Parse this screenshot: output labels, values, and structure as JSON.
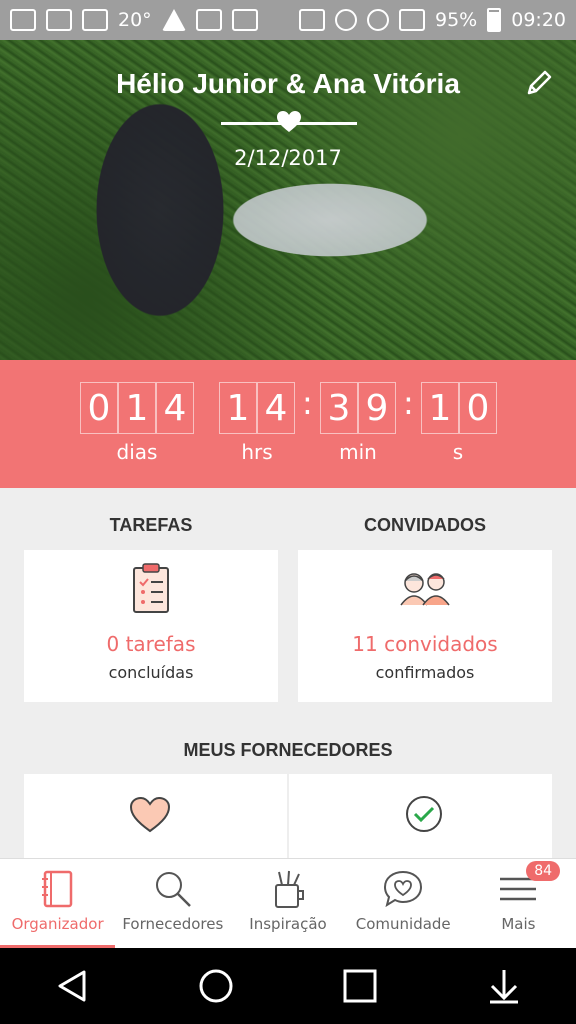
{
  "status_bar": {
    "temperature": "20°",
    "battery": "95%",
    "time": "09:20"
  },
  "hero": {
    "names": "Hélio Junior & Ana Vitória",
    "date": "2/12/2017"
  },
  "countdown": {
    "days": [
      "0",
      "1",
      "4"
    ],
    "hours": [
      "1",
      "4"
    ],
    "minutes": [
      "3",
      "9"
    ],
    "seconds": [
      "1",
      "0"
    ],
    "labels": {
      "days": "dias",
      "hours": "hrs",
      "minutes": "min",
      "seconds": "s"
    }
  },
  "tasks": {
    "title": "TAREFAS",
    "count": "0 tarefas",
    "sub": "concluídas"
  },
  "guests": {
    "title": "CONVIDADOS",
    "count": "11 convidados",
    "sub": "confirmados"
  },
  "vendors": {
    "title": "MEUS FORNECEDORES"
  },
  "nav": {
    "items": [
      {
        "label": "Organizador",
        "icon": "notebook-icon"
      },
      {
        "label": "Fornecedores",
        "icon": "search-icon"
      },
      {
        "label": "Inspiração",
        "icon": "tools-cup-icon"
      },
      {
        "label": "Comunidade",
        "icon": "chat-heart-icon"
      },
      {
        "label": "Mais",
        "icon": "menu-icon"
      }
    ],
    "badge": "84"
  },
  "colors": {
    "accent": "#ef6b6b",
    "countdown_bg": "#f27474"
  }
}
